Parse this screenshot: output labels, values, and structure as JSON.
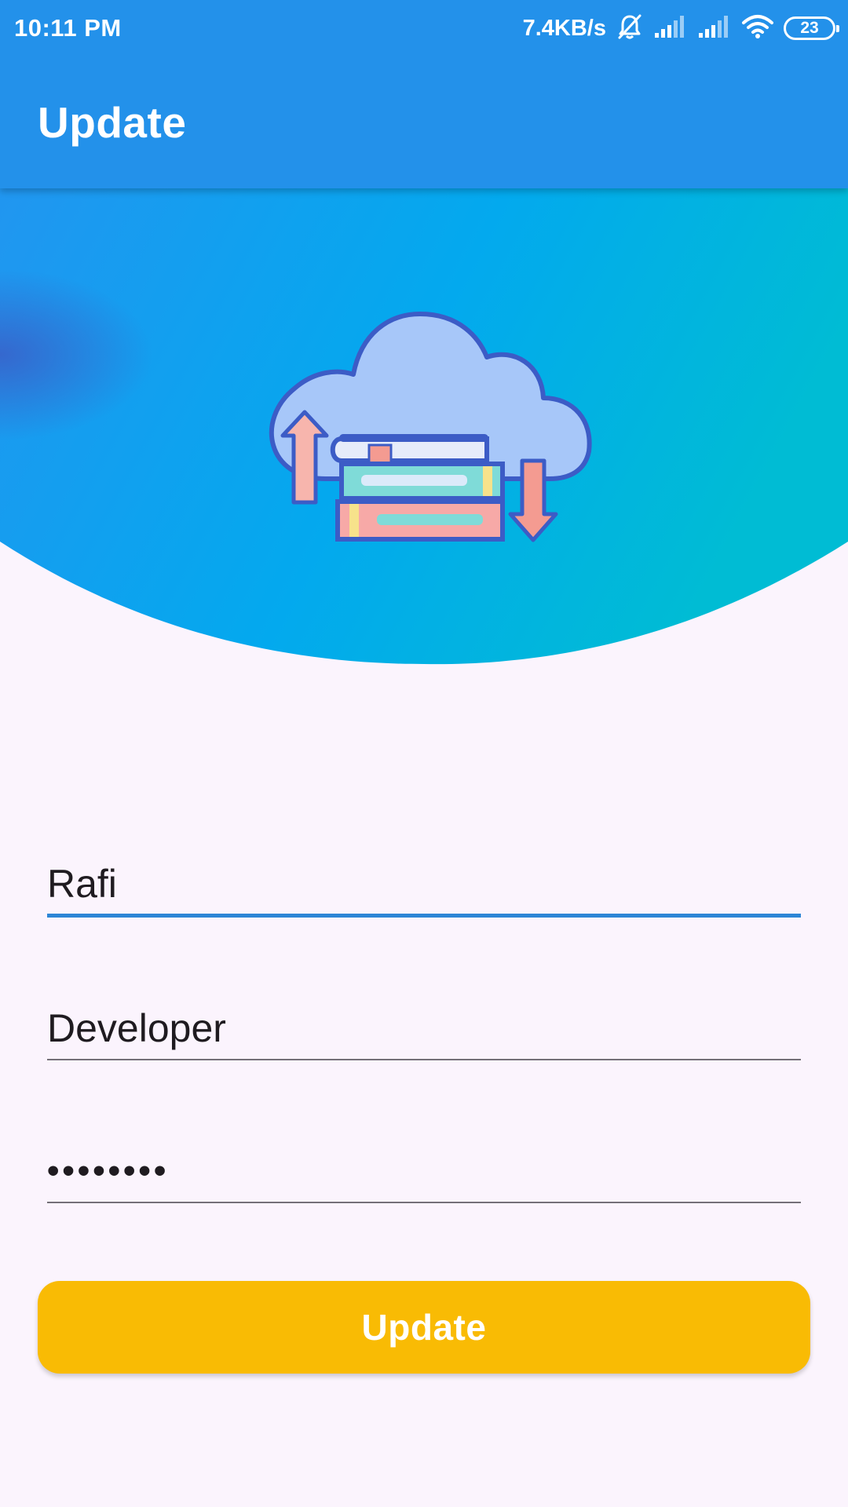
{
  "status_bar": {
    "time": "10:11 PM",
    "net_speed": "7.4KB/s",
    "battery_level": "23",
    "icons": [
      "bell-off-icon",
      "signal-icon",
      "signal-icon",
      "wifi-icon",
      "battery-icon"
    ]
  },
  "app_bar": {
    "title": "Update"
  },
  "hero": {
    "illustration": "cloud-books-sync-illustration"
  },
  "form": {
    "name_value": "Rafi",
    "role_value": "Developer",
    "password_value": "••••••••",
    "submit_label": "Update"
  },
  "colors": {
    "primary": "#2391ea",
    "accent_button": "#f9bb04",
    "background": "#fbf4fd",
    "focused_underline": "#2d86d6"
  }
}
